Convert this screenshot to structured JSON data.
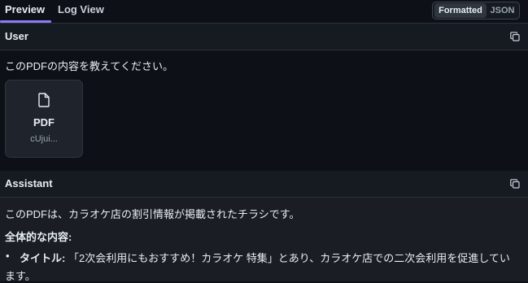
{
  "tabs": {
    "preview": "Preview",
    "log_view": "Log View"
  },
  "toggle": {
    "formatted": "Formatted",
    "json": "JSON",
    "selected": "Formatted"
  },
  "user": {
    "heading": "User",
    "message": "このPDFの内容を教えてください。",
    "attachment": {
      "type": "PDF",
      "name": "cUjui..."
    }
  },
  "assistant": {
    "heading": "Assistant",
    "intro": "このPDFは、カラオケ店の割引情報が掲載されたチラシです。",
    "overall_label": "全体的な内容:",
    "bullet": {
      "label": "タイトル:",
      "text_line1": "「2次会利用にもおすすめ！カラオケ 特集」とあり、カラオケ店での二次会利用を促進してい",
      "text_line2": "ます。"
    }
  },
  "icons": [
    "copy-icon",
    "file-icon"
  ],
  "colors": {
    "accent": "#8b7cf6",
    "background": "#0d1117",
    "panel": "#161b22"
  }
}
